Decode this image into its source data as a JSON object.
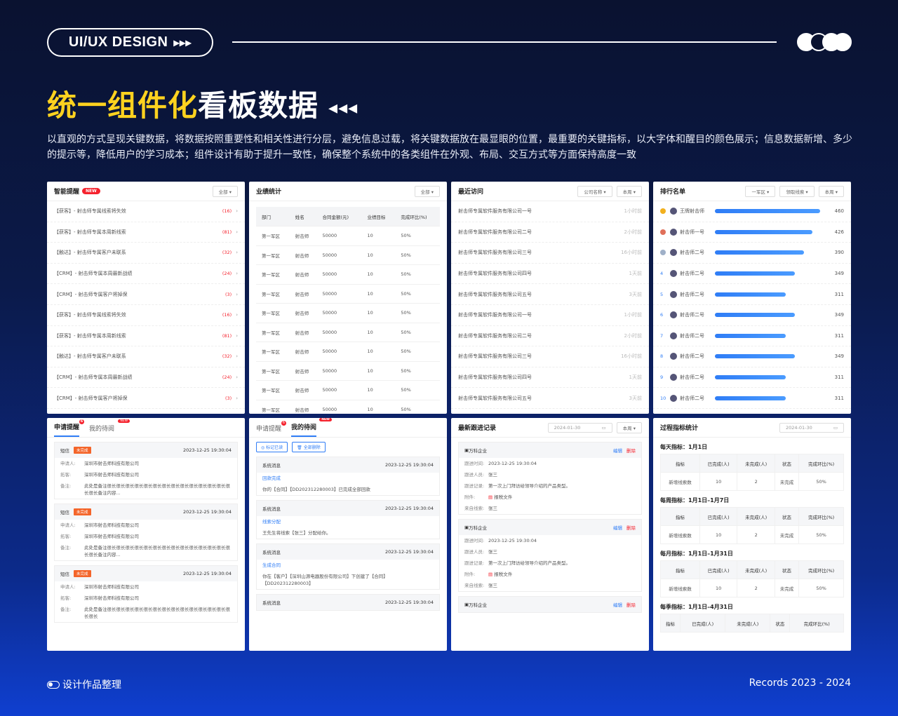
{
  "header": {
    "pill": "UI/UX DESIGN",
    "pill_arrows": "▸▸▸",
    "title_yellow": "统一组件化",
    "title_white": "看板数据",
    "title_arrows": "◂◂◂",
    "description": "以直观的方式呈现关键数据，将数据按照重要性和相关性进行分层，避免信息过载，将关键数据放在最显眼的位置，最重要的关键指标，以大字体和醒目的颜色展示；信息数据新增、多少的提示等，降低用户的学习成本；组件设计有助于提升一致性，确保整个系统中的各类组件在外观、布局、交互方式等方面保持高度一致"
  },
  "smart": {
    "title": "智能提醒",
    "new": "NEW",
    "filter": "全部 ▾",
    "items": [
      {
        "t": "【获客】- 射击师专属线索将失效",
        "c": "(16)"
      },
      {
        "t": "【获客】- 射击师专属本周新线索",
        "c": "(81)"
      },
      {
        "t": "【触达】- 射击师专属客户未联系",
        "c": "(32)"
      },
      {
        "t": "【CRM】- 射击师专属本周最新战绩",
        "c": "(24)"
      },
      {
        "t": "【CRM】- 射击师专属客户将掉保",
        "c": "(3)"
      },
      {
        "t": "【获客】- 射击师专属线索将失效",
        "c": "(16)"
      },
      {
        "t": "【获客】- 射击师专属本周新线索",
        "c": "(81)"
      },
      {
        "t": "【触达】- 射击师专属客户未联系",
        "c": "(32)"
      },
      {
        "t": "【CRM】- 射击师专属本周最新战绩",
        "c": "(24)"
      },
      {
        "t": "【CRM】- 射击师专属客户将掉保",
        "c": "(3)"
      }
    ]
  },
  "perf": {
    "title": "业绩统计",
    "filter": "全部 ▾",
    "cols": [
      "部门",
      "姓名",
      "合同金额(元)",
      "业绩目标",
      "完成环比(%)"
    ],
    "rows": [
      [
        "第一军区",
        "射击师",
        "50000",
        "10",
        "50%"
      ],
      [
        "第一军区",
        "射击师",
        "50000",
        "10",
        "50%"
      ],
      [
        "第一军区",
        "射击师",
        "50000",
        "10",
        "50%"
      ],
      [
        "第一军区",
        "射击师",
        "50000",
        "10",
        "50%"
      ],
      [
        "第一军区",
        "射击师",
        "50000",
        "10",
        "50%"
      ],
      [
        "第一军区",
        "射击师",
        "50000",
        "10",
        "50%"
      ],
      [
        "第一军区",
        "射击师",
        "50000",
        "10",
        "50%"
      ],
      [
        "第一军区",
        "射击师",
        "50000",
        "10",
        "50%"
      ],
      [
        "第一军区",
        "射击师",
        "50000",
        "10",
        "50%"
      ],
      [
        "第一军区",
        "射击师",
        "50000",
        "10",
        "50%"
      ]
    ]
  },
  "visits": {
    "title": "最近访问",
    "filter1": "公司名称 ▾",
    "filter2": "本周 ▾",
    "items": [
      {
        "n": "射击师专属软件服务有限公司一号",
        "t": "1小时前"
      },
      {
        "n": "射击师专属软件服务有限公司二号",
        "t": "2小时前"
      },
      {
        "n": "射击师专属软件服务有限公司三号",
        "t": "16小时前"
      },
      {
        "n": "射击师专属软件服务有限公司四号",
        "t": "1天前"
      },
      {
        "n": "射击师专属软件服务有限公司五号",
        "t": "3天前"
      },
      {
        "n": "射击师专属软件服务有限公司一号",
        "t": "1小时前"
      },
      {
        "n": "射击师专属软件服务有限公司二号",
        "t": "2小时前"
      },
      {
        "n": "射击师专属软件服务有限公司三号",
        "t": "16小时前"
      },
      {
        "n": "射击师专属软件服务有限公司四号",
        "t": "1天前"
      },
      {
        "n": "射击师专属软件服务有限公司五号",
        "t": "3天前"
      }
    ]
  },
  "rank": {
    "title": "排行名单",
    "filter1": "一军区 ▾",
    "filter2": "领取线索 ▾",
    "filter3": "本周 ▾",
    "max": 460,
    "items": [
      {
        "r": "",
        "n": "王牌射击师",
        "v": 460,
        "m": "#f2b01e"
      },
      {
        "r": "",
        "n": "射击师一号",
        "v": 426,
        "m": "#e0705a"
      },
      {
        "r": "",
        "n": "射击师二号",
        "v": 390,
        "m": "#9fb0c8"
      },
      {
        "r": "4",
        "n": "射击师二号",
        "v": 349
      },
      {
        "r": "5",
        "n": "射击师二号",
        "v": 311
      },
      {
        "r": "6",
        "n": "射击师二号",
        "v": 349
      },
      {
        "r": "7",
        "n": "射击师二号",
        "v": 311
      },
      {
        "r": "8",
        "n": "射击师二号",
        "v": 349
      },
      {
        "r": "9",
        "n": "射击师二号",
        "v": 311
      },
      {
        "r": "10",
        "n": "射击师二号",
        "v": 311
      }
    ]
  },
  "apply": {
    "tab1": "申请提醒",
    "tab2": "我的待阅",
    "nb": "NEW",
    "items": [
      {
        "type": "短信",
        "tag": "未完成",
        "time": "2023-12-25  19:30:04",
        "applicant_k": "申请人:",
        "applicant": "深圳市射击师科技有限公司",
        "expand_k": "拓客:",
        "expand": "深圳市射击师科技有限公司",
        "note_k": "备注:",
        "note": "此处是备注很长很长很长很长很长很长很长很长很长很长很长很长很长很长很长备注内容..."
      },
      {
        "type": "短信",
        "tag": "未完成",
        "time": "2023-12-25  19:30:04",
        "applicant_k": "申请人:",
        "applicant": "深圳市射击师科技有限公司",
        "expand_k": "拓客:",
        "expand": "深圳市射击师科技有限公司",
        "note_k": "备注:",
        "note": "此处是备注很长很长很长很长很长很长很长很长很长很长很长很长很长很长很长备注内容..."
      },
      {
        "type": "短信",
        "tag": "未完成",
        "time": "2023-12-25  19:30:04",
        "applicant_k": "申请人:",
        "applicant": "深圳市射击师科技有限公司",
        "expand_k": "拓客:",
        "expand": "深圳市射击师科技有限公司",
        "note_k": "备注:",
        "note": "此处是备注很长很长很长很长很长很长很长很长很长很长很长很长很长很长很长"
      }
    ]
  },
  "todo": {
    "tab1": "申请提醒",
    "tab2": "我的待阅",
    "nb": "NEW",
    "btn1": "标记已读",
    "btn2": "全部删除",
    "items": [
      {
        "h": "系统消息",
        "time": "2023-12-25  19:30:04",
        "link": "回款完成",
        "body": "你的【合同】【DD202312280003】已完成全部回款"
      },
      {
        "h": "系统消息",
        "time": "2023-12-25  19:30:04",
        "link": "线索分配",
        "body": "王先生将线索【张三】分配给你。"
      },
      {
        "h": "系统消息",
        "time": "2023-12-25  19:30:04",
        "link": "生成合同",
        "body": "你在【客户】【深圳山源电器股份有限公司】下创建了【合同】【DD202312280003】"
      },
      {
        "h": "系统消息",
        "time": "2023-12-25  19:30:04",
        "link": "",
        "body": ""
      }
    ]
  },
  "follow": {
    "title": "最新跟进记录",
    "date": "2024-01-30",
    "filter": "本周 ▾",
    "edit": "编辑",
    "del": "删除",
    "items": [
      {
        "name": "万科企业",
        "time_k": "跟进时间:",
        "time": "2023-12-25  19:30:04",
        "person_k": "跟进人员:",
        "person": "张三",
        "rec_k": "跟进记录:",
        "rec": "第一次上门拜访给领导介绍的产品类型。",
        "file_k": "附件:",
        "file": "报税文件",
        "src_k": "来自线索:",
        "src": "张三"
      },
      {
        "name": "万科企业",
        "time_k": "跟进时间:",
        "time": "2023-12-25  19:30:04",
        "person_k": "跟进人员:",
        "person": "张三",
        "rec_k": "跟进记录:",
        "rec": "第一次上门拜访给领导介绍的产品类型。",
        "file_k": "附件:",
        "file": "报税文件",
        "src_k": "来自线索:",
        "src": "张三"
      },
      {
        "name": "万科企业"
      }
    ]
  },
  "process": {
    "title": "过程指标统计",
    "date": "2024-01-30",
    "cols": [
      "指标",
      "已完成(人)",
      "未完成(人)",
      "状态",
      "完成环比(%)"
    ],
    "sections": [
      {
        "label": "每天指标：1月1日",
        "row": [
          "新增线索数",
          "10",
          "2",
          "未完成",
          "50%"
        ]
      },
      {
        "label": "每周指标：1月1日–1月7日",
        "row": [
          "新增线索数",
          "10",
          "2",
          "未完成",
          "50%"
        ]
      },
      {
        "label": "每月指标：1月1日–1月31日",
        "row": [
          "新增线索数",
          "10",
          "2",
          "未完成",
          "50%"
        ]
      },
      {
        "label": "每季指标：1月1日–4月31日",
        "row": null
      }
    ]
  },
  "footer": {
    "left": "设计作品整理",
    "right": "Records  2023 - 2024"
  }
}
